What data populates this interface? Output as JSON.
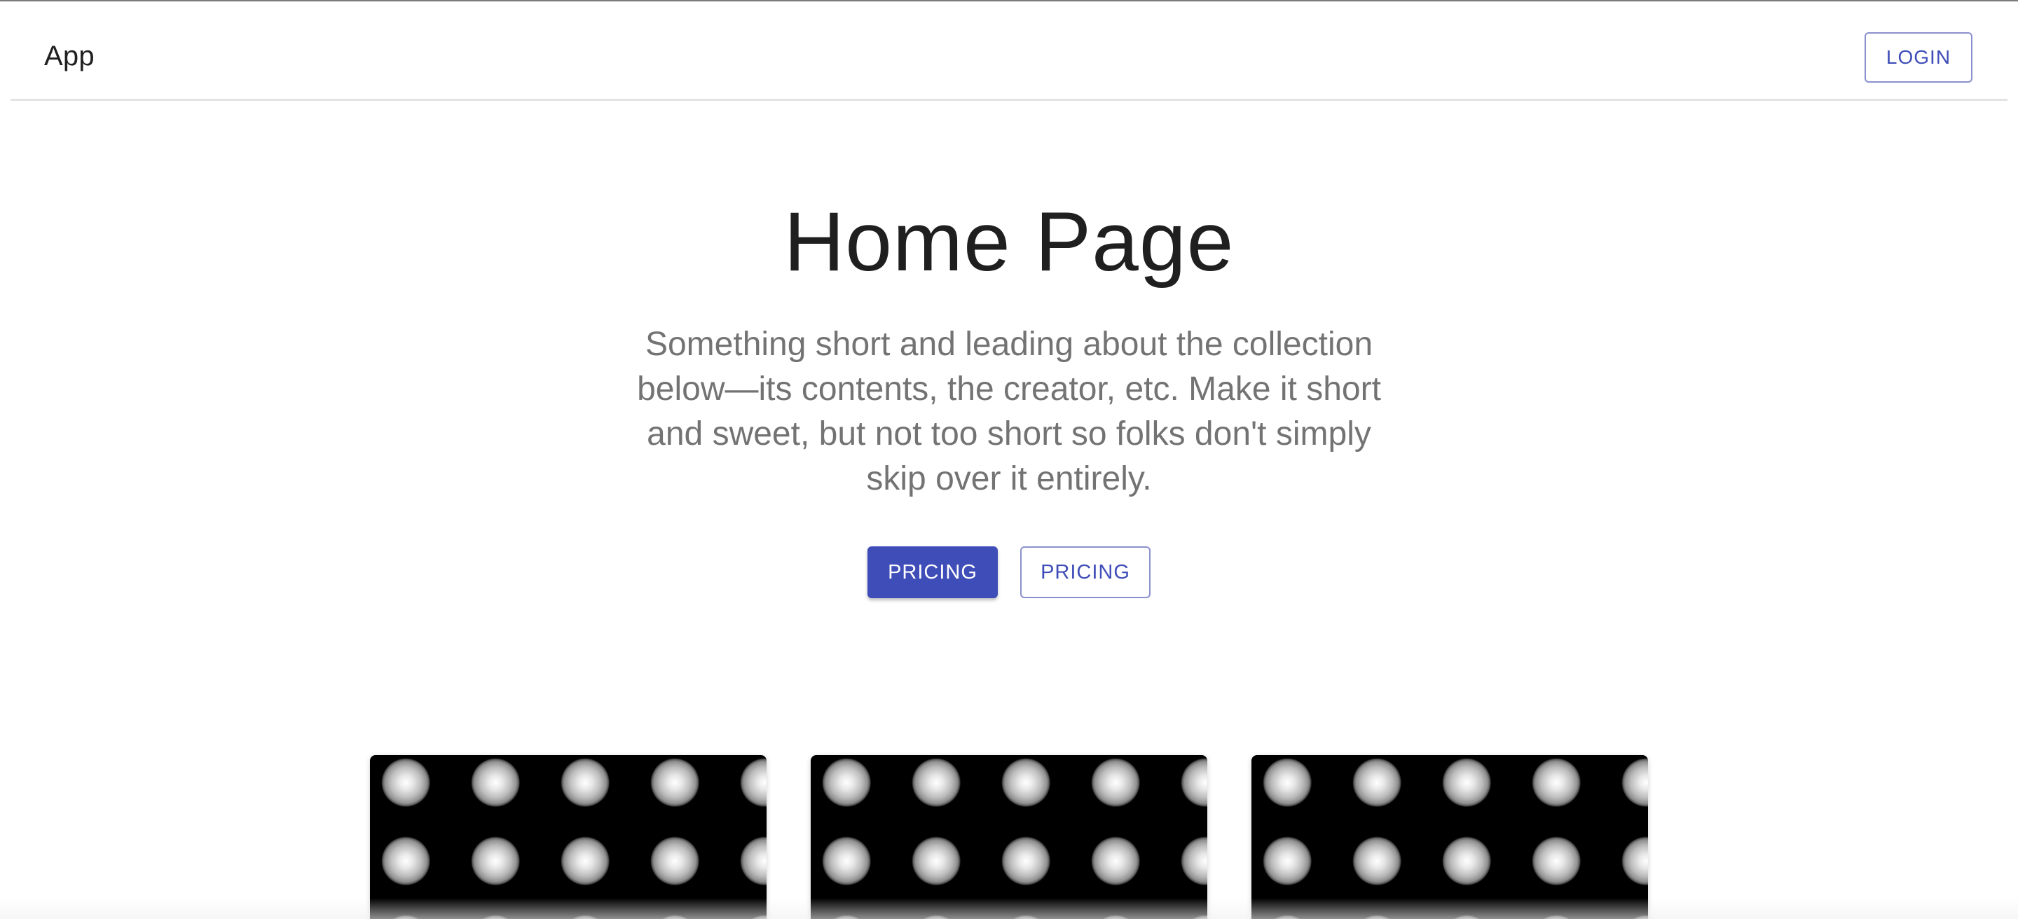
{
  "header": {
    "brand": "App",
    "login_label": "LOGIN"
  },
  "hero": {
    "title": "Home Page",
    "description": "Something short and leading about the collection below—its contents, the creator, etc. Make it short and sweet, but not too short so folks don't simply skip over it entirely.",
    "primary_button_label": "PRICING",
    "secondary_button_label": "PRICING"
  },
  "cards": [
    {
      "image": "spheres-pattern"
    },
    {
      "image": "spheres-pattern"
    },
    {
      "image": "spheres-pattern"
    }
  ],
  "colors": {
    "accent": "#3f4db8",
    "accent_border": "#8a91cc",
    "text_primary": "#1f1f1f",
    "text_secondary": "#737373"
  }
}
